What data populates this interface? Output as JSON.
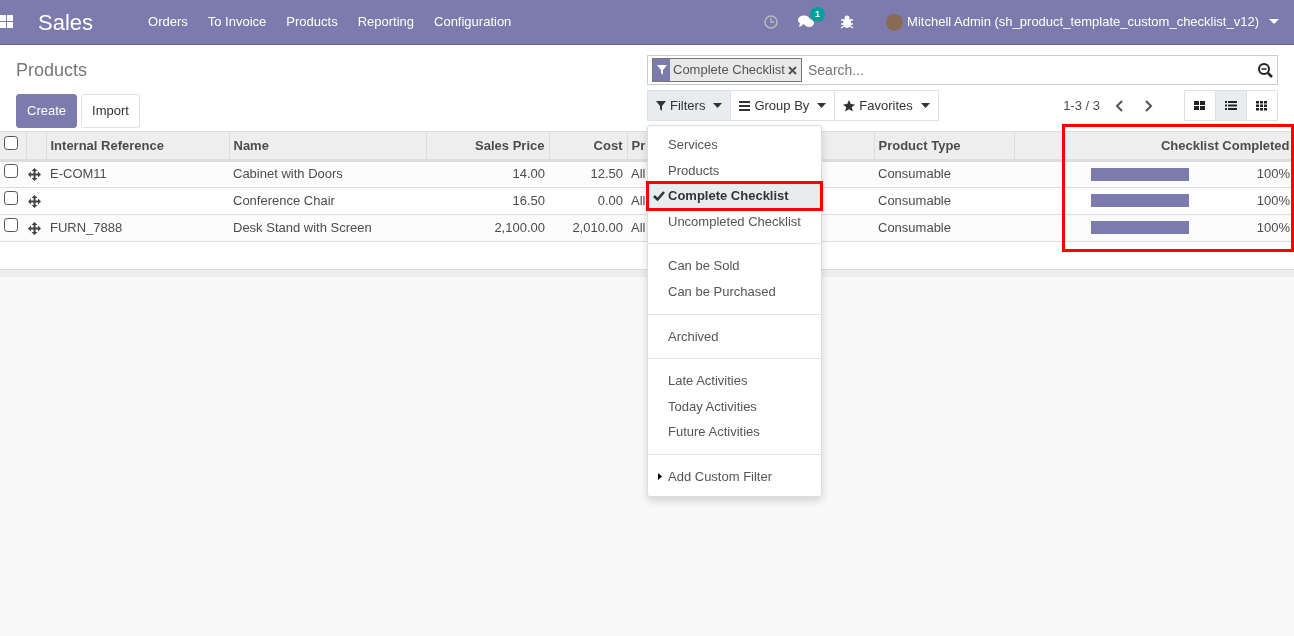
{
  "navbar": {
    "app": "Sales",
    "menu": [
      "Orders",
      "To Invoice",
      "Products",
      "Reporting",
      "Configuration"
    ],
    "messages_count": "1",
    "user": "Mitchell Admin (sh_product_template_custom_checklist_v12)"
  },
  "breadcrumb": "Products",
  "buttons": [
    {
      "label": "Create",
      "kind": "primary"
    },
    {
      "label": "Import",
      "kind": "secondary"
    }
  ],
  "search": {
    "facets": [
      "Complete Checklist"
    ],
    "placeholder": "Search..."
  },
  "search_options": [
    {
      "label": "Filters",
      "selected": true
    },
    {
      "label": "Group By",
      "selected": false
    },
    {
      "label": "Favorites",
      "selected": false
    }
  ],
  "pager": "1-3 / 3",
  "views": [
    {
      "kind": "kanban",
      "selected": false
    },
    {
      "kind": "list",
      "selected": true
    },
    {
      "kind": "grid",
      "selected": false
    }
  ],
  "table": {
    "all_checked": false,
    "columns": [
      {
        "label": "Internal Reference",
        "kind": "text",
        "highlighted": false
      },
      {
        "label": "Name",
        "kind": "text",
        "highlighted": false
      },
      {
        "label": "Sales Price",
        "kind": "number",
        "highlighted": false
      },
      {
        "label": "Cost",
        "kind": "number",
        "highlighted": false
      },
      {
        "label": "Pr",
        "kind": "text",
        "highlighted": false
      },
      {
        "label": "Product Type",
        "kind": "text",
        "highlighted": false
      },
      {
        "kind": "text",
        "highlighted": false
      },
      {
        "label": "Checklist Completed",
        "kind": "number",
        "highlighted": true
      }
    ],
    "rows": [
      {
        "checked": false,
        "cells": [
          "E-COM11",
          "Cabinet with Doors",
          "14.00",
          "12.50",
          "All",
          "Consumable",
          ""
        ],
        "level": 1,
        "reading": "100%"
      },
      {
        "checked": false,
        "cells": [
          "",
          "Conference Chair",
          "16.50",
          "0.00",
          "All",
          "Consumable",
          ""
        ],
        "level": 1,
        "reading": "100%"
      },
      {
        "checked": false,
        "cells": [
          "FURN_7888",
          "Desk Stand with Screen",
          "2,100.00",
          "2,010.00",
          "All",
          "Consumable",
          ""
        ],
        "level": 1,
        "reading": "100%"
      }
    ]
  },
  "filter_menu": [
    {
      "group": [
        {
          "label": "Services",
          "checked": false,
          "highlighted": false
        },
        {
          "label": "Products",
          "checked": false,
          "highlighted": false
        },
        {
          "label": "Complete Checklist",
          "checked": true,
          "highlighted": true
        },
        {
          "label": "Uncompleted Checklist",
          "checked": false,
          "highlighted": false
        }
      ]
    },
    {
      "group": [
        {
          "label": "Can be Sold",
          "checked": false,
          "highlighted": false
        },
        {
          "label": "Can be Purchased",
          "checked": false,
          "highlighted": false
        }
      ]
    },
    {
      "group": [
        {
          "label": "Archived",
          "checked": false,
          "highlighted": false
        }
      ]
    },
    {
      "group": [
        {
          "label": "Late Activities",
          "checked": false,
          "highlighted": false
        },
        {
          "label": "Today Activities",
          "checked": false,
          "highlighted": false
        },
        {
          "label": "Future Activities",
          "checked": false,
          "highlighted": false
        }
      ]
    },
    {
      "group": [
        {
          "label": "Add Custom Filter",
          "checked": false,
          "highlighted": false,
          "kind": "expander"
        }
      ]
    }
  ]
}
